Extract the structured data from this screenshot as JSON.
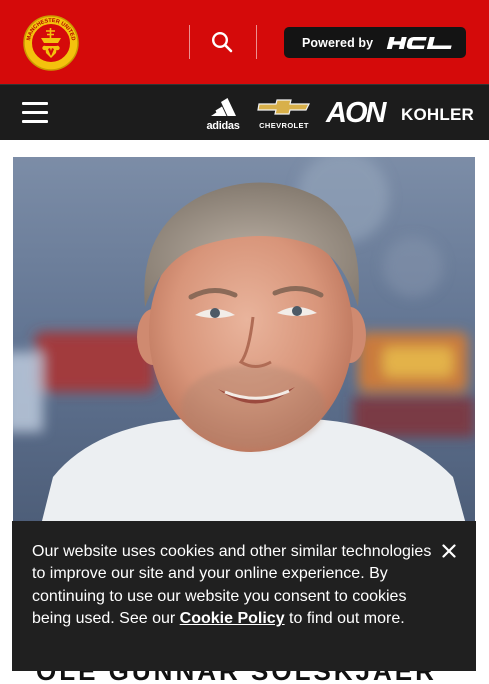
{
  "header": {
    "logo": "manchester-united-crest",
    "logo_text": "MANCHESTER UNITED",
    "search_icon": "search-icon",
    "powered_by_label": "Powered by",
    "partner_logo": "HCL",
    "colors": {
      "primary_red": "#d50a0a",
      "dark_bar": "#1c1c1c"
    }
  },
  "nav": {
    "menu_icon": "hamburger-menu-icon",
    "sponsors": [
      "adidas",
      "CHEVROLET",
      "AON",
      "KOHLER"
    ]
  },
  "hero": {
    "image": "photo of a smiling man with grey hair at a press conference"
  },
  "headline_fragment": "OLE GUNNAR SOLSKJAER",
  "cookie_banner": {
    "text_before_link": "Our website uses cookies and other similar technologies to improve our site and your online experience. By continuing to use our website you consent to cookies being used. See our ",
    "link_text": "Cookie Policy",
    "text_after_link": " to find out more.",
    "close_icon": "close-icon",
    "background": "#202020"
  }
}
